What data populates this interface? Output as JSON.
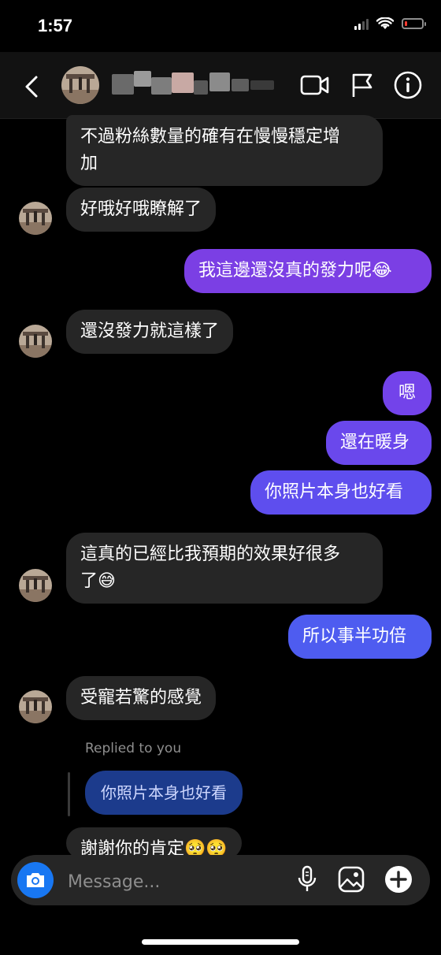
{
  "status_bar": {
    "time": "1:57",
    "icons": [
      "signal-icon",
      "wifi-icon",
      "battery-low-icon"
    ]
  },
  "header": {
    "back_icon": "chevron-left-icon",
    "video_icon": "video-call-icon",
    "flag_icon": "flag-icon",
    "info_icon": "info-icon"
  },
  "messages": [
    {
      "from": "them",
      "text": "不過粉絲數量的確有在慢慢穩定增\n加"
    },
    {
      "from": "them",
      "text": "好哦好哦瞭解了"
    },
    {
      "from": "me",
      "text": "我這邊還沒真的發力呢😂"
    },
    {
      "from": "them",
      "text": "還沒發力就這樣了"
    },
    {
      "from": "me",
      "text": "嗯"
    },
    {
      "from": "me",
      "text": "還在暖身"
    },
    {
      "from": "me",
      "text": "你照片本身也好看"
    },
    {
      "from": "them",
      "text": "這真的已經比我預期的效果好很多\n了😅"
    },
    {
      "from": "me",
      "text": "所以事半功倍"
    },
    {
      "from": "them",
      "text": "受寵若驚的感覺"
    },
    {
      "from": "them",
      "reply_label": "Replied to you",
      "quoted_text": "你照片本身也好看"
    },
    {
      "from": "them",
      "text": "謝謝你的肯定🥺🥺"
    }
  ],
  "composer": {
    "placeholder": "Message...",
    "camera_icon": "camera-icon",
    "mic_icon": "microphone-icon",
    "gallery_icon": "image-gallery-icon",
    "add_icon": "plus-circle-icon"
  },
  "colors": {
    "background": "#000000",
    "incoming_bubble": "#262626",
    "outgoing_purple": "#7b3fe4",
    "outgoing_blue": "#4e5cf0",
    "camera_button": "#1877f2"
  }
}
